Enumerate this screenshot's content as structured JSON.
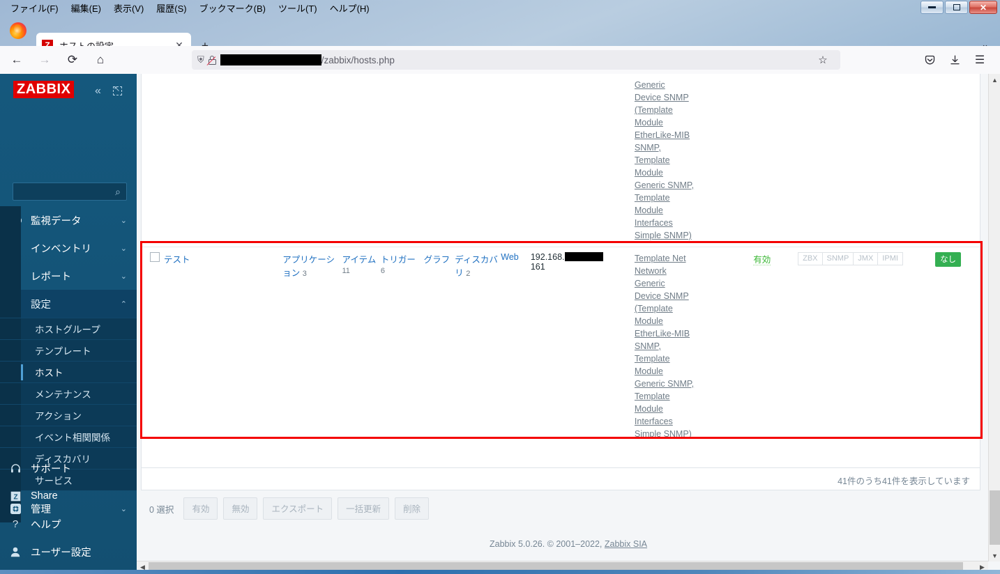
{
  "browser": {
    "menus": [
      {
        "label": "ファイル(F)"
      },
      {
        "label": "編集(E)"
      },
      {
        "label": "表示(V)"
      },
      {
        "label": "履歴(S)"
      },
      {
        "label": "ブックマーク(B)"
      },
      {
        "label": "ツール(T)"
      },
      {
        "label": "ヘルプ(H)"
      }
    ],
    "window_controls": {
      "minimize": "–",
      "maximize": "□",
      "close": "✕"
    },
    "tab": {
      "favicon_letter": "Z",
      "title": "ホストの設定",
      "close": "✕"
    },
    "new_tab": "+",
    "tab_overflow": "⌄",
    "nav": {
      "back": "←",
      "forward": "→",
      "reload": "⟳",
      "home": "⌂"
    },
    "url": {
      "redacted": true,
      "path": "/zabbix/hosts.php"
    },
    "toolbar_right": {
      "star": "☆",
      "pocket": "pocket-icon",
      "download": "download-icon",
      "menu": "☰"
    }
  },
  "sidebar": {
    "logo": "ZABBIX",
    "collapse": "«",
    "search_placeholder": "",
    "search_value": "",
    "top_items": [
      {
        "icon": "eye-icon",
        "glyph": "◉",
        "label": "監視データ",
        "chevron": "⌄"
      },
      {
        "icon": "list-icon",
        "glyph": "☰",
        "label": "インベントリ",
        "chevron": "⌄"
      },
      {
        "icon": "chart-icon",
        "glyph": "▥",
        "label": "レポート",
        "chevron": "⌄"
      },
      {
        "icon": "wrench-icon",
        "glyph": "🔧",
        "label": "設定",
        "chevron": "⌃",
        "open": true
      }
    ],
    "submenu": [
      {
        "label": "ホストグループ",
        "selected": false
      },
      {
        "label": "テンプレート",
        "selected": false
      },
      {
        "label": "ホスト",
        "selected": true
      },
      {
        "label": "メンテナンス",
        "selected": false
      },
      {
        "label": "アクション",
        "selected": false
      },
      {
        "label": "イベント相関関係",
        "selected": false
      },
      {
        "label": "ディスカバリ",
        "selected": false
      },
      {
        "label": "サービス",
        "selected": false
      }
    ],
    "admin_item": {
      "icon": "gear-icon",
      "glyph": "✥",
      "label": "管理",
      "chevron": "⌄"
    },
    "bottom_items": [
      {
        "icon": "support-icon",
        "glyph": "☊",
        "label": "サポート"
      },
      {
        "icon": "share-icon",
        "glyph": "Z",
        "label": "Share"
      },
      {
        "icon": "help-icon",
        "glyph": "?",
        "label": "ヘルプ"
      },
      {
        "icon": "user-icon",
        "glyph": "👤",
        "label": "ユーザー設定"
      }
    ]
  },
  "table": {
    "partial_row": {
      "templates": [
        "Generic",
        "Device SNMP",
        "(Template",
        "Module",
        "EtherLike-MIB",
        "SNMP,",
        "Template",
        "Module",
        "Generic SNMP,",
        "Template",
        "Module",
        "Interfaces",
        "Simple SNMP)"
      ]
    },
    "highlighted_row": {
      "checkbox_checked": false,
      "name": "テスト",
      "applications": {
        "label": "アプリケーション",
        "count": "3"
      },
      "items": {
        "label": "アイテム",
        "count": "11"
      },
      "triggers": {
        "label": "トリガー",
        "count": "6"
      },
      "graphs": {
        "label": "グラフ",
        "count": ""
      },
      "discovery": {
        "label": "ディスカバリ",
        "count": "2"
      },
      "web": {
        "label": "Web",
        "count": ""
      },
      "interface": {
        "ip": "192.168.",
        "redacted": true,
        "port": "161"
      },
      "templates": [
        "Template Net",
        "Network",
        "Generic",
        "Device SNMP",
        "(Template",
        "Module",
        "EtherLike-MIB",
        "SNMP,",
        "Template",
        "Module",
        "Generic SNMP,",
        "Template",
        "Module",
        "Interfaces",
        "Simple SNMP)"
      ],
      "status": "有効",
      "availability": [
        "ZBX",
        "SNMP",
        "JMX",
        "IPMI"
      ],
      "tag": "なし"
    }
  },
  "count_bar": {
    "text": "41件のうち41件を表示しています"
  },
  "actionbar": {
    "selected_label": "0 選択",
    "buttons": [
      {
        "label": "有効"
      },
      {
        "label": "無効"
      },
      {
        "label": "エクスポート"
      },
      {
        "label": "一括更新"
      },
      {
        "label": "削除"
      }
    ]
  },
  "footer": {
    "text": "Zabbix 5.0.26. © 2001–2022, ",
    "link": "Zabbix SIA"
  },
  "colors": {
    "zabbix_red": "#e00000",
    "sidebar_blue": "#15577c",
    "link_blue": "#1f70c1",
    "status_green": "#3db837",
    "tag_green": "#34af52",
    "highlight_red": "#f40000"
  }
}
